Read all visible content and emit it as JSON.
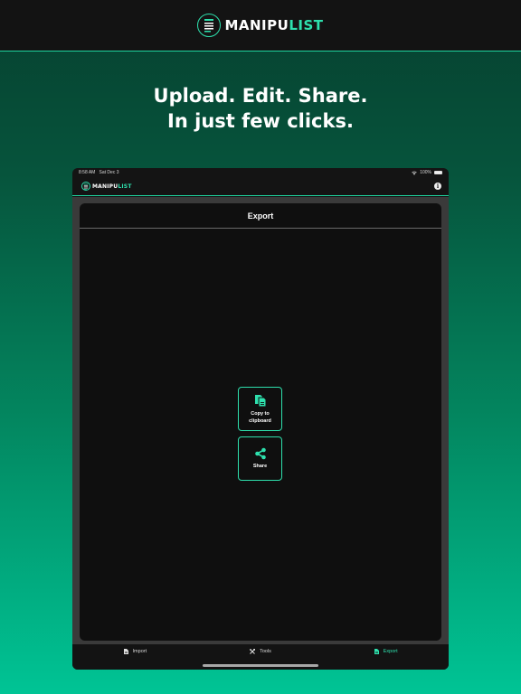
{
  "brand": {
    "name_part1": "MANIPU",
    "name_part2": "LIST",
    "accent_color": "#2ee0ad"
  },
  "headline": {
    "line1": "Upload. Edit. Share.",
    "line2": "In just few clicks."
  },
  "device": {
    "status": {
      "time": "8:58 AM",
      "date": "Sat Dec 3",
      "battery": "100%",
      "icons": [
        "wifi-icon",
        "battery-icon"
      ]
    },
    "appbar": {
      "info_icon": "info-icon",
      "info_glyph": "i"
    },
    "export_sheet": {
      "title": "Export",
      "actions": [
        {
          "id": "copy",
          "label_line1": "Copy to",
          "label_line2": "clipboard",
          "icon": "clipboard-copy-icon"
        },
        {
          "id": "share",
          "label": "Share",
          "icon": "share-icon"
        }
      ]
    },
    "tabbar": {
      "tabs": [
        {
          "label": "Import",
          "icon": "document-icon",
          "active": false
        },
        {
          "label": "Tools",
          "icon": "tools-icon",
          "active": false
        },
        {
          "label": "Export",
          "icon": "document-icon",
          "active": true
        }
      ]
    }
  }
}
